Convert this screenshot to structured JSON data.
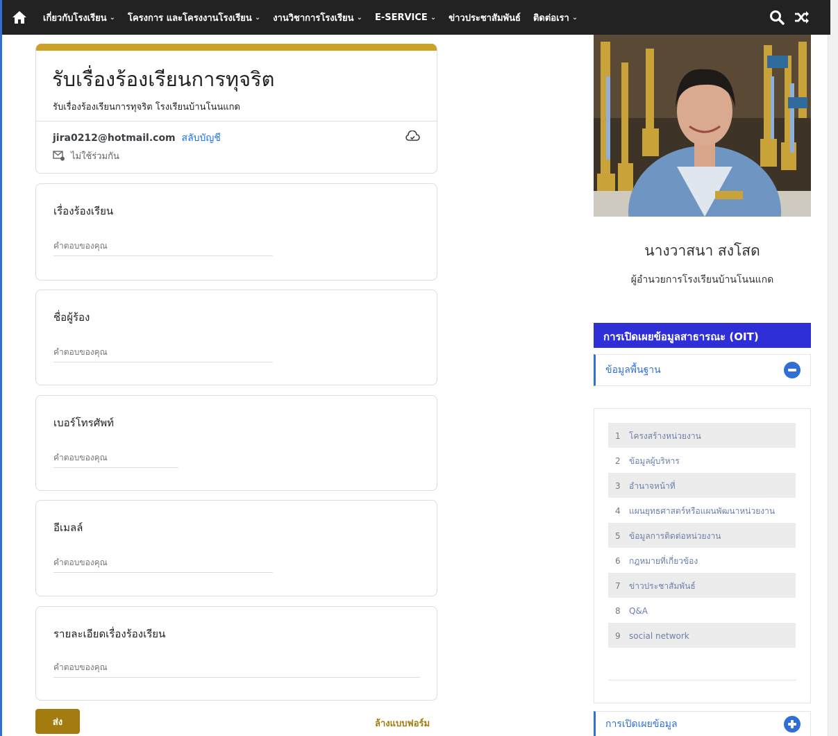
{
  "nav": {
    "items": [
      {
        "label": "เกี่ยวกับโรงเรียน",
        "dropdown": true
      },
      {
        "label": "โครงการ และโครงงานโรงเรียน",
        "dropdown": true
      },
      {
        "label": "งานวิชาการโรงเรียน",
        "dropdown": true
      },
      {
        "label": "E-SERVICE",
        "dropdown": true
      },
      {
        "label": "ข่าวประชาสัมพันธ์",
        "dropdown": false
      },
      {
        "label": "ติดต่อเรา",
        "dropdown": true
      }
    ],
    "chevron": "⌄"
  },
  "form": {
    "title": "รับเรื่องร้องเรียนการทุจริต",
    "description": "รับเรื่องร้องเรียนการทุจริต โรงเรียนบ้านโนนแกด",
    "account_email": "jira0212@hotmail.com",
    "switch_account": "สลับบัญชี",
    "not_shared": "ไม่ใช้ร่วมกัน",
    "questions": [
      {
        "label": "เรื่องร้องเรียน",
        "placeholder": "คำตอบของคุณ"
      },
      {
        "label": "ชื่อผู้ร้อง",
        "placeholder": "คำตอบของคุณ"
      },
      {
        "label": "เบอร์โทรศัพท์",
        "placeholder": "คำตอบของคุณ"
      },
      {
        "label": "อีเมลล์",
        "placeholder": "คำตอบของคุณ"
      },
      {
        "label": "รายละเอียดเรื่องร้องเรียน",
        "placeholder": "คำตอบของคุณ"
      }
    ],
    "submit": "ส่ง",
    "clear": "ล้างแบบฟอร์ม"
  },
  "sidebar": {
    "person_name": "นางวาสนา สงโสด",
    "person_role": "ผู้อำนวยการโรงเรียนบ้านโนนแกด",
    "oit_title": "การเปิดเผยข้อมูลสาธารณะ (OIT)",
    "section1": "ข้อมูลพื้นฐาน",
    "items": [
      {
        "num": "1",
        "label": "โครงสร้างหน่วยงาน"
      },
      {
        "num": "2",
        "label": "ข้อมูลผู้บริหาร"
      },
      {
        "num": "3",
        "label": "อำนาจหน้าที่"
      },
      {
        "num": "4",
        "label": "แผนยุทธศาสตร์หรือแผนพัฒนาหน่วยงาน"
      },
      {
        "num": "5",
        "label": "ข้อมูลการติดต่อหน่วยงาน"
      },
      {
        "num": "6",
        "label": "กฎหมายที่เกี่ยวข้อง"
      },
      {
        "num": "7",
        "label": "ข่าวประชาสัมพันธ์"
      },
      {
        "num": "8",
        "label": "Q&A"
      },
      {
        "num": "9",
        "label": "social network"
      }
    ],
    "section2": "การเปิดเผยข้อมูล"
  },
  "colors": {
    "navbar": "#222222",
    "form_accent": "#c9a227",
    "submit": "#a37b0e",
    "oit_header": "#2f2fd8",
    "link_blue": "#2f6fd6"
  },
  "icons": [
    "home-icon",
    "search-icon",
    "shuffle-icon",
    "cloud-saved-icon",
    "mail-settings-icon",
    "collapse-icon",
    "expand-icon"
  ]
}
